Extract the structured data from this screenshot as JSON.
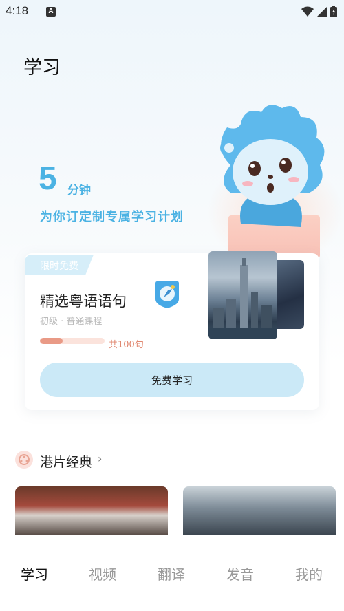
{
  "status_bar": {
    "time": "4:18",
    "notification_icon": "A"
  },
  "page": {
    "title": "学习"
  },
  "hero": {
    "number": "5",
    "unit": "分钟",
    "subtitle": "为你订定制专属学习计划"
  },
  "card": {
    "tag": "限时免费",
    "title": "精选粤语语句",
    "meta": "初级 · 普通课程",
    "progress": 0.35,
    "count_label": "共100句",
    "button_label": "免费学习"
  },
  "section": {
    "title": "港片经典"
  },
  "tabs": [
    {
      "label": "学习",
      "active": true
    },
    {
      "label": "视频",
      "active": false
    },
    {
      "label": "翻译",
      "active": false
    },
    {
      "label": "发音",
      "active": false
    },
    {
      "label": "我的",
      "active": false
    }
  ],
  "colors": {
    "accent": "#4bb2e3",
    "button_bg": "#cbe9f7",
    "progress_fill": "#e99a86"
  }
}
